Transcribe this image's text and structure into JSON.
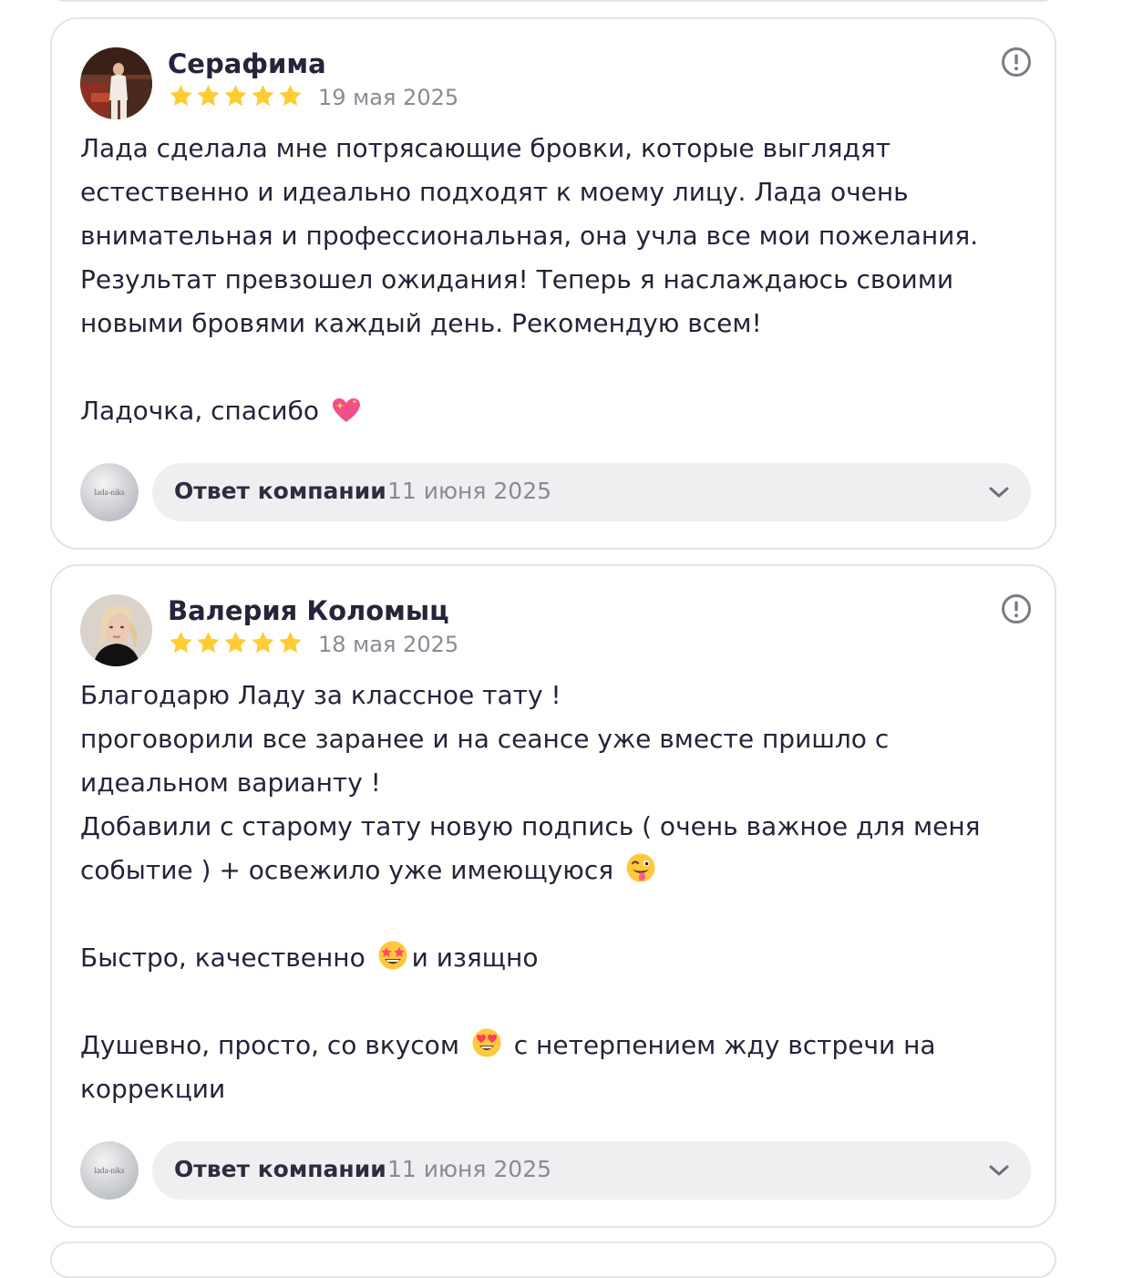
{
  "reviews": [
    {
      "author": "Серафима",
      "rating": 5,
      "date": "19 мая 2025",
      "paragraphs": [
        "Лада сделала мне потрясающие бровки, которые выглядят естественно и идеально подходят к моему лицу. Лада очень внимательная и профессиональная, она учла все мои пожелания. Результат превзошел ожидания! Теперь я наслаждаюсь своими новыми бровями каждый день. Рекомендую всем!",
        "Ладочка, спасибо"
      ],
      "reply": {
        "label": "Ответ компании",
        "date": "11 июня 2025",
        "company_logo_text": "lada-niks"
      }
    },
    {
      "author": "Валерия Коломыц",
      "rating": 5,
      "date": "18 мая 2025",
      "lines": [
        "Благодарю Ладу за классное тату !",
        "проговорили все заранее и на сеансе уже вместе пришло с идеальном варианту !",
        "Добавили с старому тату новую подпись ( очень важное для меня событие ) + освежило уже имеющуюся",
        "Быстро, качественно",
        "и изящно",
        "Душевно, просто, со вкусом",
        "с нетерпением жду встречи на коррекции"
      ],
      "reply": {
        "label": "Ответ компании",
        "date": "11 июня 2025",
        "company_logo_text": "lada-niks"
      }
    }
  ],
  "icons": {
    "report": "exclamation-circle-icon",
    "expand": "chevron-down-icon",
    "star": "star-icon",
    "emoji_1": "sparkling-heart-emoji",
    "emoji_2": "winking-face-with-tongue-emoji",
    "emoji_3": "star-struck-emoji",
    "emoji_4": "smiling-face-with-heart-eyes-emoji"
  },
  "colors": {
    "star": "#ffcc33",
    "card_border": "#e4e4e8",
    "reply_bg": "#efeff1",
    "muted_text": "#8a8a96"
  }
}
